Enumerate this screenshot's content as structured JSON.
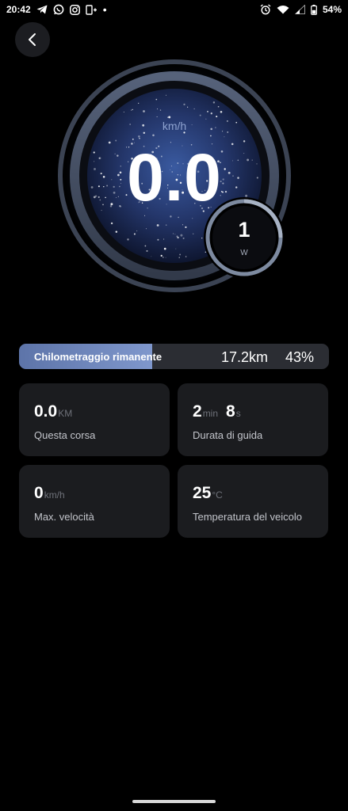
{
  "status_bar": {
    "time": "20:42",
    "battery": "54%",
    "dot": "•",
    "left_icons": [
      "telegram-icon",
      "whatsapp-icon",
      "instagram-icon",
      "usb-tether-icon"
    ],
    "right_icons": [
      "alarm-icon",
      "wifi-icon",
      "signal-icon",
      "battery-icon"
    ]
  },
  "back_button": {
    "icon": "chevron-left-icon"
  },
  "speedometer": {
    "unit": "km/h",
    "value": "0.0"
  },
  "power": {
    "value": "1",
    "unit": "W"
  },
  "remaining_mileage": {
    "label": "Chilometraggio rimanente",
    "distance": "17.2km",
    "percent": "43%",
    "fill_fraction": 0.43
  },
  "cards": {
    "trip": {
      "value": "0.0",
      "unit": "KM",
      "label": "Questa corsa"
    },
    "duration": {
      "minutes": "2",
      "min_unit": "min",
      "seconds": "8",
      "sec_unit": "s",
      "label": "Durata di guida"
    },
    "max_speed": {
      "value": "0",
      "unit": "km/h",
      "label": "Max. velocità"
    },
    "temperature": {
      "value": "25",
      "unit": "°C",
      "label": "Temperatura del veicolo"
    }
  },
  "colors": {
    "background": "#000000",
    "card": "#1b1c1f",
    "accent": "#7f97cc",
    "dial_ring": "#3d4656"
  }
}
